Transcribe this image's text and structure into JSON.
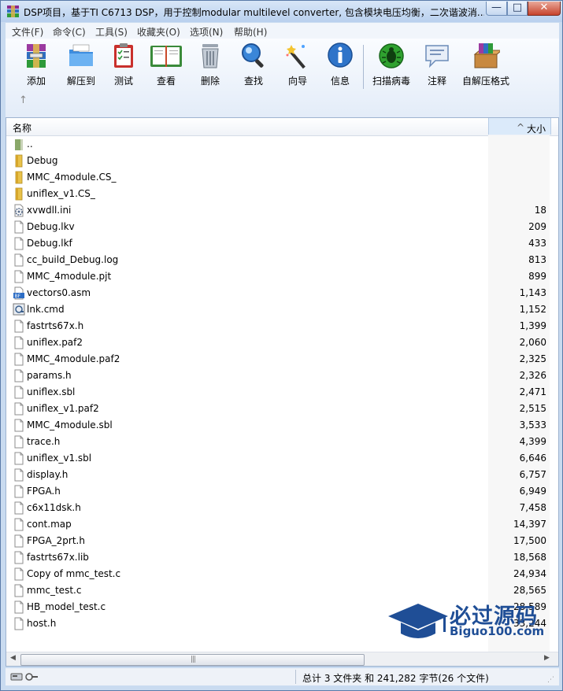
{
  "window": {
    "title": "DSP项目，基于TI C6713 DSP，用于控制modular multilevel converter, 包含模块电压均衡，二次谐波消...",
    "controls": {
      "minimize": "—",
      "maximize": "□",
      "close": "✕"
    }
  },
  "menu": [
    "文件(F)",
    "命令(C)",
    "工具(S)",
    "收藏夹(O)",
    "选项(N)",
    "帮助(H)"
  ],
  "toolbar": [
    {
      "label": "添加",
      "icon": "rar-archive-icon"
    },
    {
      "label": "解压到",
      "icon": "extract-folder-icon"
    },
    {
      "label": "测试",
      "icon": "test-clipboard-icon"
    },
    {
      "label": "查看",
      "icon": "book-view-icon"
    },
    {
      "label": "删除",
      "icon": "trash-icon"
    },
    {
      "label": "查找",
      "icon": "magnifier-icon"
    },
    {
      "label": "向导",
      "icon": "wizard-wand-icon"
    },
    {
      "label": "信息",
      "icon": "info-icon"
    },
    {
      "label": "扫描病毒",
      "icon": "virus-scan-icon"
    },
    {
      "label": "注释",
      "icon": "comment-icon"
    },
    {
      "label": "自解压格式",
      "icon": "sfx-box-icon"
    }
  ],
  "up_arrow": "↑",
  "columns": {
    "name": "名称",
    "size": "大小"
  },
  "files": [
    {
      "name": "..",
      "size": "",
      "type": "parent"
    },
    {
      "name": "Debug",
      "size": "",
      "type": "folder"
    },
    {
      "name": "MMC_4module.CS_",
      "size": "",
      "type": "folder"
    },
    {
      "name": "uniflex_v1.CS_",
      "size": "",
      "type": "folder"
    },
    {
      "name": "xvwdll.ini",
      "size": "18",
      "type": "ini"
    },
    {
      "name": "Debug.lkv",
      "size": "209",
      "type": "file"
    },
    {
      "name": "Debug.lkf",
      "size": "433",
      "type": "file"
    },
    {
      "name": "cc_build_Debug.log",
      "size": "813",
      "type": "file"
    },
    {
      "name": "MMC_4module.pjt",
      "size": "899",
      "type": "file"
    },
    {
      "name": "vectors0.asm",
      "size": "1,143",
      "type": "asm"
    },
    {
      "name": "lnk.cmd",
      "size": "1,152",
      "type": "cmd"
    },
    {
      "name": "fastrts67x.h",
      "size": "1,399",
      "type": "file"
    },
    {
      "name": "uniflex.paf2",
      "size": "2,060",
      "type": "file"
    },
    {
      "name": "MMC_4module.paf2",
      "size": "2,325",
      "type": "file"
    },
    {
      "name": "params.h",
      "size": "2,326",
      "type": "file"
    },
    {
      "name": "uniflex.sbl",
      "size": "2,471",
      "type": "file"
    },
    {
      "name": "uniflex_v1.paf2",
      "size": "2,515",
      "type": "file"
    },
    {
      "name": "MMC_4module.sbl",
      "size": "3,533",
      "type": "file"
    },
    {
      "name": "trace.h",
      "size": "4,399",
      "type": "file"
    },
    {
      "name": "uniflex_v1.sbl",
      "size": "6,646",
      "type": "file"
    },
    {
      "name": "display.h",
      "size": "6,757",
      "type": "file"
    },
    {
      "name": "FPGA.h",
      "size": "6,949",
      "type": "file"
    },
    {
      "name": "c6x11dsk.h",
      "size": "7,458",
      "type": "file"
    },
    {
      "name": "cont.map",
      "size": "14,397",
      "type": "file"
    },
    {
      "name": "FPGA_2prt.h",
      "size": "17,500",
      "type": "file"
    },
    {
      "name": "fastrts67x.lib",
      "size": "18,568",
      "type": "file"
    },
    {
      "name": "Copy of mmc_test.c",
      "size": "24,934",
      "type": "file"
    },
    {
      "name": "mmc_test.c",
      "size": "28,565",
      "type": "file"
    },
    {
      "name": "HB_model_test.c",
      "size": "28,589",
      "type": "file"
    },
    {
      "name": "host.h",
      "size": "33,244",
      "type": "file"
    }
  ],
  "status": {
    "summary": "总计 3 文件夹 和 241,282 字节(26 个文件)"
  },
  "watermark": {
    "title": "必过源码",
    "url": "Biguo100.com"
  },
  "colors": {
    "accent": "#1f4e96",
    "toolbar_bg": "#e3ecf8",
    "header_selected": "#dbeafa"
  }
}
